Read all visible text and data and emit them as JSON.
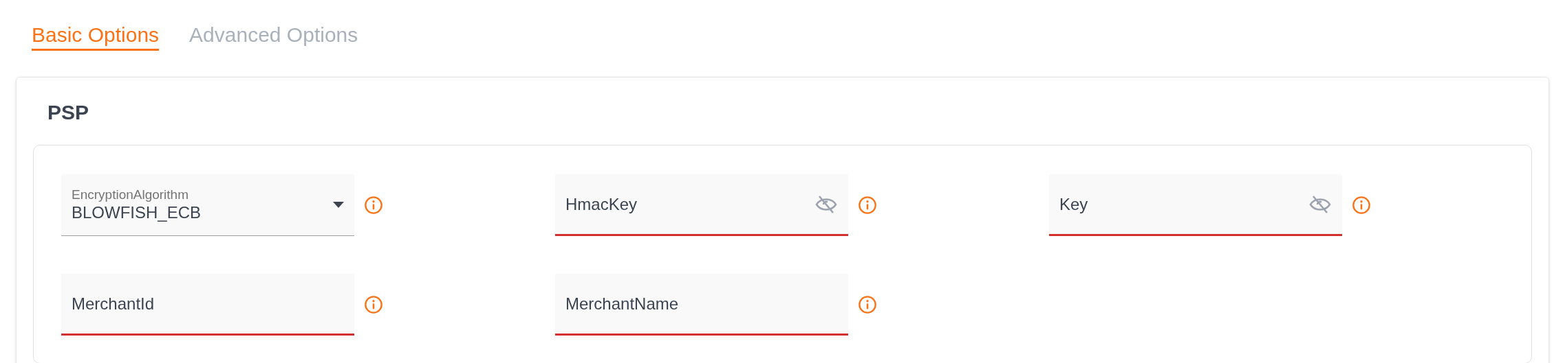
{
  "tabs": [
    {
      "label": "Basic Options",
      "selected": true
    },
    {
      "label": "Advanced Options",
      "selected": false
    }
  ],
  "section": {
    "title": "PSP"
  },
  "fields": [
    {
      "kind": "select",
      "label": "EncryptionAlgorithm",
      "value": "BLOWFISH_ECB",
      "error": false
    },
    {
      "kind": "password",
      "label": "HmacKey",
      "error": true
    },
    {
      "kind": "password",
      "label": "Key",
      "error": true
    },
    {
      "kind": "text",
      "label": "MerchantId",
      "error": true
    },
    {
      "kind": "text",
      "label": "MerchantName",
      "error": true
    }
  ]
}
